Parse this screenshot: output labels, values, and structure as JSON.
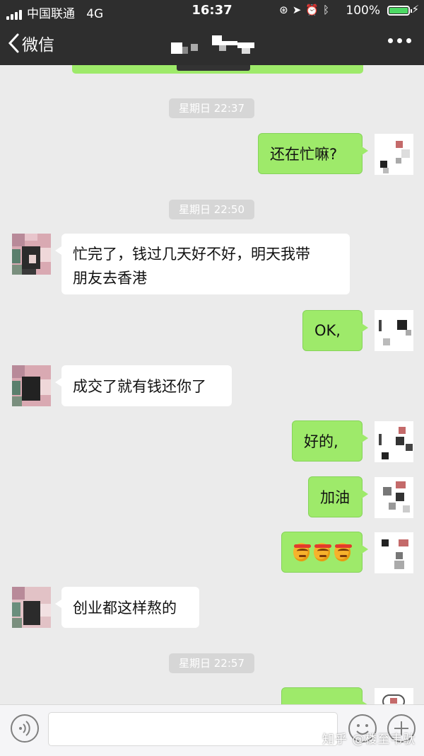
{
  "status_bar": {
    "carrier": "中国联通",
    "network": "4G",
    "time": "16:37",
    "battery": "100%",
    "battery_level": 1.0
  },
  "nav": {
    "back_label": "微信",
    "title_obscured": true
  },
  "colors": {
    "bar_bg": "#2e2e2e",
    "chat_bg": "#ebebeb",
    "outgoing_bubble": "#9eea6a",
    "incoming_bubble": "#ffffff",
    "timestamp_bg": "#d6d6d6",
    "battery_green": "#4cd964"
  },
  "messages": {
    "ts1": "星期日 22:37",
    "m1": "还在忙嘛?",
    "ts2": "星期日 22:50",
    "m2_line1": "忙完了，钱过几天好不好，明天我带",
    "m2_line2": "朋友去香港",
    "m3": "OK,",
    "m4": "成交了就有钱还你了",
    "m5": "好的,",
    "m6": "加油",
    "m7_emoji": [
      "angry-face-emoji",
      "angry-face-emoji",
      "angry-face-emoji"
    ],
    "m8": "创业都这样熬的",
    "ts3": "星期日 22:57"
  },
  "input_bar": {
    "placeholder": "",
    "watermark": "知乎 @楼至韦驮"
  }
}
